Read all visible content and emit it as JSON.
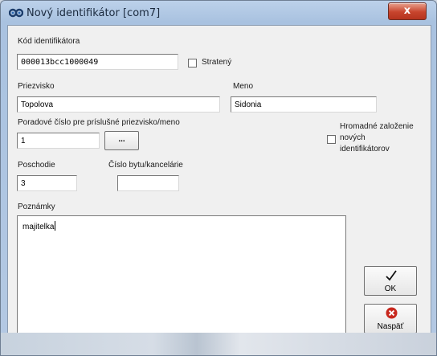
{
  "window": {
    "title": "Nový identifikátor [com7]",
    "close_label": "x"
  },
  "form": {
    "kod_label": "Kód identifikátora",
    "kod_value": "000013bcc1000049",
    "straten_label": "Stratený",
    "priezvisko_label": "Priezvisko",
    "priezvisko_value": "Topolova",
    "meno_label": "Meno",
    "meno_value": "Sidonia",
    "poradove_label": "Poradové číslo pre príslušné priezvisko/meno",
    "poradove_value": "1",
    "ellipsis_label": "...",
    "hromadne_line1": "Hromadné založenie",
    "hromadne_line2": "nových",
    "hromadne_line3": "identifikátorov",
    "poschodie_label": "Poschodie",
    "poschodie_value": "3",
    "cislo_bytu_label": "Číslo bytu/kancelárie",
    "cislo_bytu_value": "",
    "poznamky_label": "Poznámky",
    "poznamky_value": "majitelka"
  },
  "buttons": {
    "ok_label": "OK",
    "back_label": "Naspäť"
  },
  "icons": {
    "app": "infinity-app-icon",
    "ok": "checkmark-icon",
    "back": "red-x-circle-icon"
  }
}
